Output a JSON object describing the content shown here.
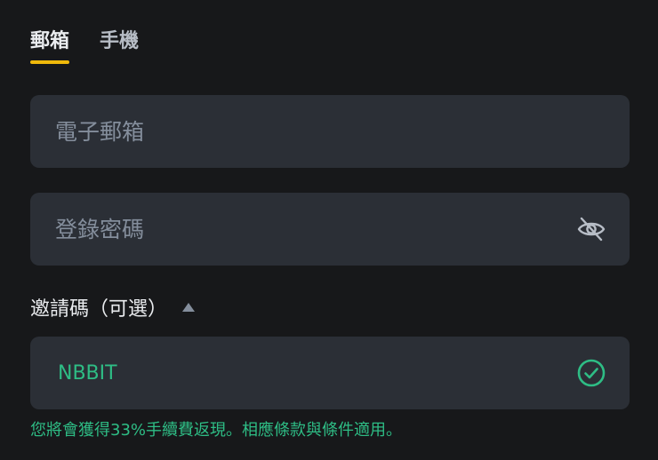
{
  "tabs": [
    {
      "label": "郵箱",
      "active": true
    },
    {
      "label": "手機",
      "active": false
    }
  ],
  "email_field": {
    "placeholder": "電子郵箱",
    "value": ""
  },
  "password_field": {
    "placeholder": "登錄密碼",
    "value": "",
    "toggle_icon": "eye-off-icon"
  },
  "referral": {
    "label": "邀請碼（可選）",
    "toggle_icon": "caret-up-icon",
    "value": "NBBIT",
    "status_icon": "check-circle-icon",
    "note": "您將會獲得33%手續費返現。相應條款與條件適用。"
  },
  "colors": {
    "background": "#17181a",
    "field_background": "#2b2f36",
    "accent": "#f0b90b",
    "success": "#2ebd85",
    "placeholder": "#848e9c"
  }
}
